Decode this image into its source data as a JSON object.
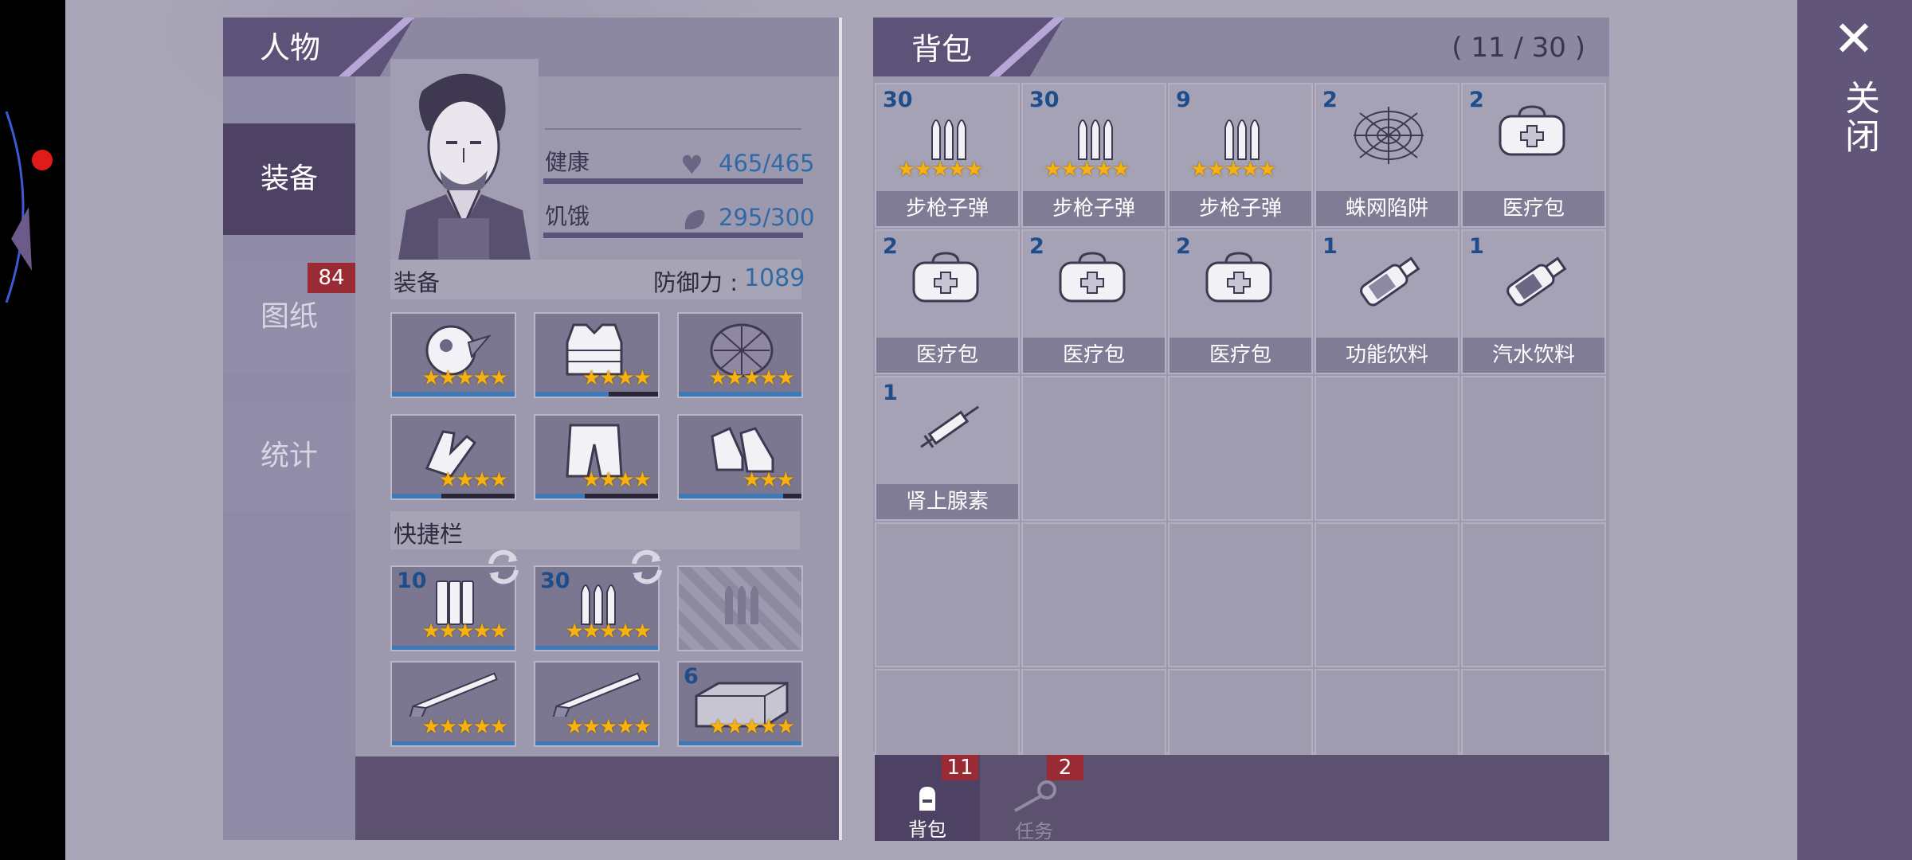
{
  "character": {
    "title": "人物",
    "tabs": [
      {
        "label": "装备",
        "active": true
      },
      {
        "label": "图纸",
        "badge": "84"
      },
      {
        "label": "统计"
      }
    ],
    "stats": {
      "health_label": "健康",
      "health_value": "465/465",
      "hunger_label": "饥饿",
      "hunger_value": "295/300"
    },
    "equipment": {
      "label": "装备",
      "defense_label": "防御力 :",
      "defense_value": "1089",
      "slots": [
        {
          "icon": "gas-mask-icon",
          "stars": "★★★★★",
          "durability": 1.0
        },
        {
          "icon": "armor-vest-icon",
          "stars": "★★★★",
          "durability": 0.6
        },
        {
          "icon": "turtle-shell-icon",
          "stars": "★★★★★",
          "durability": 1.0
        },
        {
          "icon": "gloves-icon",
          "stars": "★★★★",
          "durability": 0.4
        },
        {
          "icon": "pants-icon",
          "stars": "★★★★",
          "durability": 0.4
        },
        {
          "icon": "boots-icon",
          "stars": "★★★",
          "durability": 0.85
        }
      ]
    },
    "quickbar": {
      "label": "快捷栏",
      "slots": [
        {
          "icon": "shotgun-shells-icon",
          "qty": "10",
          "stars": "★★★★★",
          "refresh": true
        },
        {
          "icon": "rifle-ammo-icon",
          "qty": "30",
          "stars": "★★★★★",
          "refresh": true
        },
        {
          "icon": "empty-ammo-slot-icon",
          "qty": "",
          "stars": "",
          "locked": true
        },
        {
          "icon": "shotgun-icon",
          "qty": "",
          "stars": "★★★★★"
        },
        {
          "icon": "rifle-icon",
          "qty": "",
          "stars": "★★★★★"
        },
        {
          "icon": "brick-icon",
          "qty": "6",
          "stars": "★★★★★"
        }
      ]
    }
  },
  "backpack": {
    "title": "背包",
    "capacity": "( 11 / 30 )",
    "items": [
      {
        "qty": "30",
        "name": "步枪子弹",
        "icon": "rifle-ammo-icon",
        "stars": "★★★★★"
      },
      {
        "qty": "30",
        "name": "步枪子弹",
        "icon": "rifle-ammo-icon",
        "stars": "★★★★★"
      },
      {
        "qty": "9",
        "name": "步枪子弹",
        "icon": "rifle-ammo-icon",
        "stars": "★★★★★"
      },
      {
        "qty": "2",
        "name": "蛛网陷阱",
        "icon": "spiderweb-trap-icon",
        "stars": ""
      },
      {
        "qty": "2",
        "name": "医疗包",
        "icon": "medkit-icon",
        "stars": ""
      },
      {
        "qty": "2",
        "name": "医疗包",
        "icon": "medkit-icon",
        "stars": ""
      },
      {
        "qty": "2",
        "name": "医疗包",
        "icon": "medkit-icon",
        "stars": ""
      },
      {
        "qty": "2",
        "name": "医疗包",
        "icon": "medkit-icon",
        "stars": ""
      },
      {
        "qty": "1",
        "name": "功能饮料",
        "icon": "energy-drink-icon",
        "stars": ""
      },
      {
        "qty": "1",
        "name": "汽水饮料",
        "icon": "soda-icon",
        "stars": ""
      },
      {
        "qty": "1",
        "name": "肾上腺素",
        "icon": "syringe-icon",
        "stars": ""
      }
    ]
  },
  "bottom_nav": [
    {
      "label": "背包",
      "badge": "11",
      "icon": "backpack-icon",
      "active": true
    },
    {
      "label": "任务",
      "badge": "2",
      "icon": "key-icon",
      "active": false
    }
  ],
  "close": {
    "label": "关闭",
    "icon": "close-icon"
  }
}
